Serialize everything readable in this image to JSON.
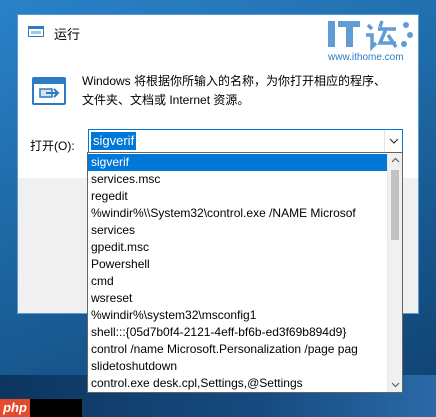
{
  "window": {
    "title": "运行"
  },
  "watermark": {
    "logo_text": "IT之家",
    "url": "www.ithome.com"
  },
  "description": [
    "Windows 将根据你所输入的名称，为你打开相应的程序、",
    "文件夹、文档或 Internet 资源。"
  ],
  "open_field": {
    "label": "打开(O):",
    "value": "sigverif"
  },
  "history": [
    "sigverif",
    "services.msc",
    "regedit",
    "%windir%\\\\System32\\control.exe /NAME Microsof",
    "services",
    "gpedit.msc",
    "Powershell",
    "cmd",
    "wsreset",
    "%windir%\\system32\\msconfig1",
    "shell:::{05d7b0f4-2121-4eff-bf6b-ed3f69b894d9}",
    "control /name Microsoft.Personalization /page pag",
    "slidetoshutdown",
    "control.exe desk.cpl,Settings,@Settings"
  ],
  "selected_index": 0,
  "overlay": {
    "badge": "php"
  },
  "colors": {
    "accent": "#0078d7",
    "badge": "#e24b2b"
  }
}
